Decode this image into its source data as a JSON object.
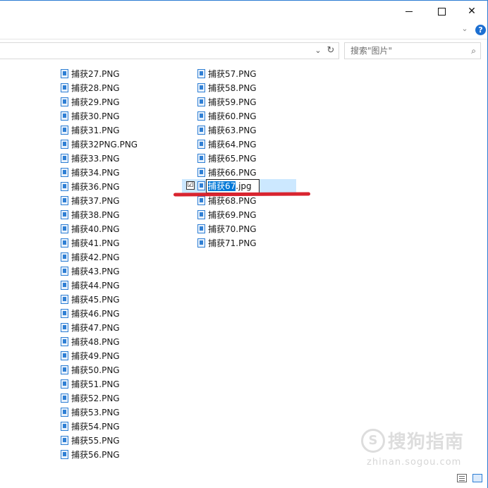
{
  "window": {
    "minimize_icon": "minimize-icon",
    "maximize_icon": "maximize-icon",
    "close_glyph": "✕"
  },
  "ribbon": {
    "chevron_glyph": "⌄",
    "help_glyph": "?"
  },
  "address": {
    "dropdown_glyph": "⌄",
    "refresh_glyph": "↻"
  },
  "search": {
    "placeholder": "搜索\"图片\"",
    "icon_glyph": "⌕"
  },
  "files": {
    "column1": [
      "捕获27.PNG",
      "捕获28.PNG",
      "捕获29.PNG",
      "捕获30.PNG",
      "捕获31.PNG",
      "捕获32PNG.PNG",
      "捕获33.PNG",
      "捕获34.PNG",
      "捕获36.PNG",
      "捕获37.PNG",
      "捕获38.PNG",
      "捕获40.PNG",
      "捕获41.PNG",
      "捕获42.PNG",
      "捕获43.PNG",
      "捕获44.PNG",
      "捕获45.PNG",
      "捕获46.PNG",
      "捕获47.PNG",
      "捕获48.PNG",
      "捕获49.PNG",
      "捕获50.PNG",
      "捕获51.PNG",
      "捕获52.PNG",
      "捕获53.PNG",
      "捕获54.PNG",
      "捕获55.PNG",
      "捕获56.PNG"
    ],
    "column2_before": [
      "捕获57.PNG",
      "捕获58.PNG",
      "捕获59.PNG",
      "捕获60.PNG",
      "捕获63.PNG",
      "捕获64.PNG",
      "捕获65.PNG",
      "捕获66.PNG"
    ],
    "renaming": {
      "name_part": "捕获67",
      "ext_part": ".jpg",
      "checkbox_glyph": "☑"
    },
    "column2_after": [
      "捕获68.PNG",
      "捕获69.PNG",
      "捕获70.PNG",
      "捕获71.PNG"
    ]
  },
  "watermark": {
    "logo": "S",
    "text": "搜狗指南",
    "url": "zhinan.sogou.com"
  },
  "colors": {
    "accent": "#2b7bd3",
    "selection": "#cce8ff",
    "annotation_red": "#d9242f"
  }
}
